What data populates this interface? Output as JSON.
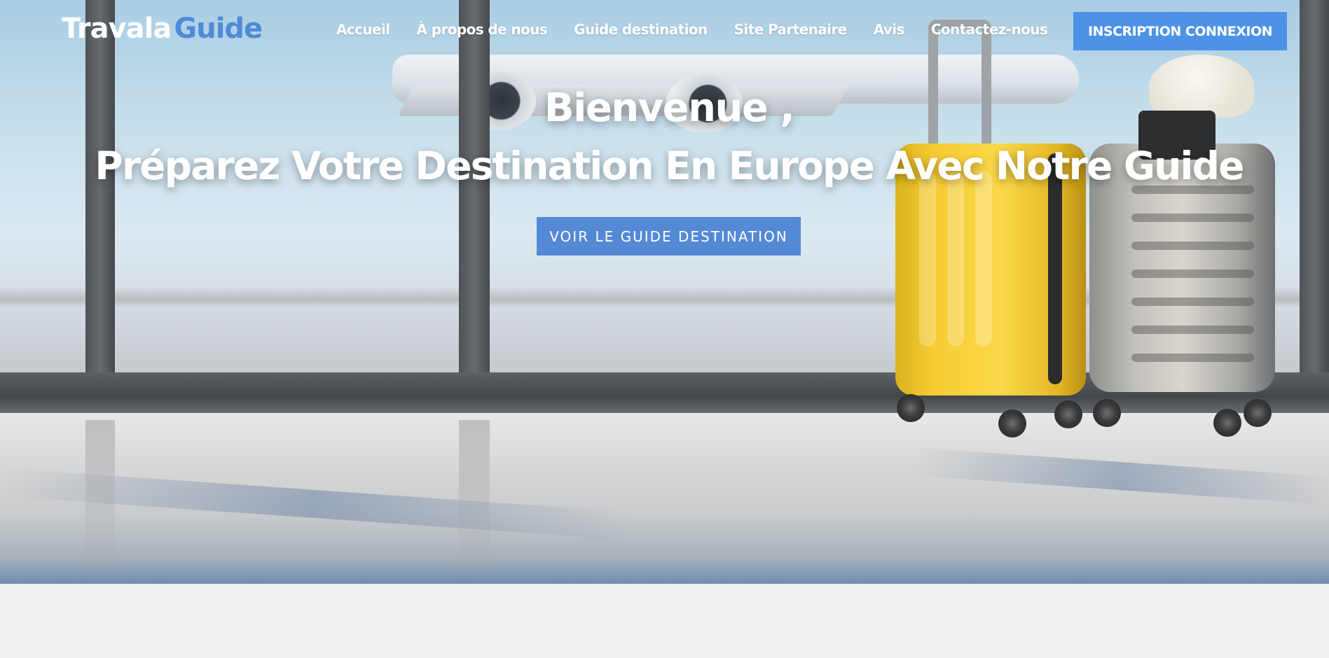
{
  "brand": {
    "part1": "Travala",
    "part2": "Guide"
  },
  "nav": {
    "items": [
      {
        "label": "Accueil"
      },
      {
        "label": "À propos de nous"
      },
      {
        "label": "Guide destination"
      },
      {
        "label": "Site Partenaire"
      },
      {
        "label": "Avis"
      },
      {
        "label": "Contactez-nous"
      }
    ],
    "auth_label": "INSCRIPTION CONNEXION"
  },
  "hero": {
    "title": "Bienvenue ,",
    "subtitle": "Préparez Votre Destination En Europe Avec Notre Guide",
    "cta_label": "VOIR LE GUIDE DESTINATION"
  },
  "colors": {
    "accent": "#4f8ad9",
    "button": "#4d92e6",
    "cta": "#5489d6",
    "page_background": "#f0f0f1"
  }
}
